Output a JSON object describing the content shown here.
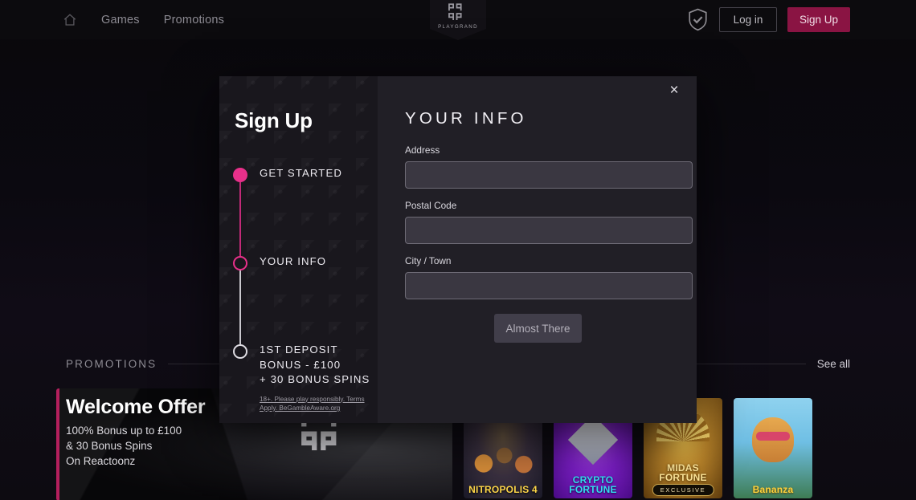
{
  "header": {
    "home_icon": "home-icon",
    "nav": [
      {
        "label": "Games"
      },
      {
        "label": "Promotions"
      }
    ],
    "logo": {
      "text": "PLAYGRAND",
      "mark": "playgrand-monogram"
    },
    "shield_icon": "shield-check-icon",
    "login_label": "Log in",
    "signup_label": "Sign Up",
    "signup_color": "#8a1443"
  },
  "modal": {
    "title": "Sign Up",
    "close_icon": "×",
    "accent_color": "#e8308a",
    "steps": [
      {
        "label": "GET STARTED",
        "state": "done"
      },
      {
        "label": "YOUR INFO",
        "state": "current"
      },
      {
        "label": "1ST DEPOSIT BONUS - £100\n+ 30 BONUS SPINS",
        "state": "future",
        "fineprint": "18+. Please play responsibly. Terms Apply. BeGambleAware.org"
      }
    ],
    "panel": {
      "heading": "YOUR INFO",
      "fields": [
        {
          "label": "Address",
          "value": "",
          "placeholder": ""
        },
        {
          "label": "Postal Code",
          "value": "",
          "placeholder": ""
        },
        {
          "label": "City / Town",
          "value": "",
          "placeholder": ""
        }
      ],
      "submit_label": "Almost There"
    }
  },
  "promotions": {
    "title": "PROMOTIONS",
    "see_all_label": "See all",
    "offer": {
      "title": "Welcome Offer",
      "line1": "100% Bonus up to £100",
      "line2": "& 30 Bonus Spins",
      "line3": "On Reactoonz"
    },
    "tiles": [
      {
        "name": "NITROPOLIS 4",
        "badge": ""
      },
      {
        "name": "CRYPTO FORTUNE",
        "badge": ""
      },
      {
        "name": "MIDAS FORTUNE",
        "badge": "EXCLUSIVE"
      },
      {
        "name": "Bananza",
        "badge": ""
      }
    ]
  }
}
